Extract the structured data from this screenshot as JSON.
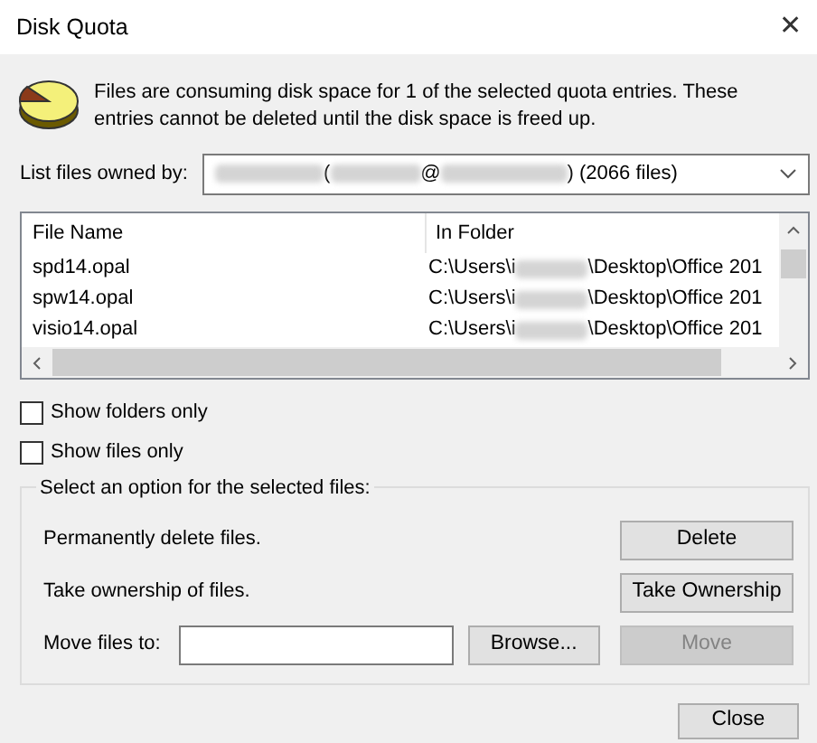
{
  "window": {
    "title": "Disk Quota",
    "close_glyph": "✕"
  },
  "message": "Files are consuming disk space for 1 of the selected quota entries.  These entries cannot be deleted until the disk space is freed up.",
  "owner": {
    "label": "List files owned by:",
    "value_parts": [
      "(",
      "@",
      ") (2066 files)"
    ]
  },
  "file_list": {
    "columns": [
      "File Name",
      "In Folder"
    ],
    "rows": [
      {
        "name": "spd14.opal",
        "folder_parts": [
          "C:\\Users\\i",
          "\\Desktop\\Office 201"
        ]
      },
      {
        "name": "spw14.opal",
        "folder_parts": [
          "C:\\Users\\i",
          "\\Desktop\\Office 201"
        ]
      },
      {
        "name": "visio14.opal",
        "folder_parts": [
          "C:\\Users\\i",
          "\\Desktop\\Office 201"
        ]
      }
    ]
  },
  "filters": [
    {
      "label": "Show folders only",
      "checked": false
    },
    {
      "label": "Show files only",
      "checked": false
    }
  ],
  "options": {
    "title": "Select an option for the selected files:",
    "rows": [
      {
        "kind": "action",
        "label": "Permanently delete files.",
        "button": "Delete",
        "disabled": false
      },
      {
        "kind": "action",
        "label": "Take ownership of files.",
        "button": "Take Ownership",
        "disabled": false
      },
      {
        "kind": "move",
        "label": "Move files to:",
        "browse": "Browse...",
        "button": "Move",
        "disabled": true
      }
    ]
  },
  "footer_button": "Close"
}
